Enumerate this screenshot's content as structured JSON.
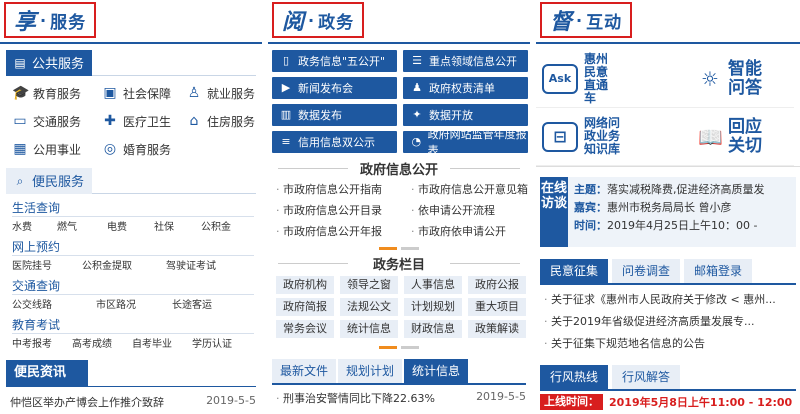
{
  "col1": {
    "glyph": "享",
    "title": "服务",
    "public": {
      "label": "公共服务",
      "items": [
        {
          "icon": "graduation-cap-icon",
          "label": "教育服务"
        },
        {
          "icon": "id-card-icon",
          "label": "社会保障"
        },
        {
          "icon": "person-icon",
          "label": "就业服务"
        },
        {
          "icon": "bus-icon",
          "label": "交通服务"
        },
        {
          "icon": "medical-icon",
          "label": "医疗卫生"
        },
        {
          "icon": "house-icon",
          "label": "住房服务"
        },
        {
          "icon": "building-icon",
          "label": "公用事业"
        },
        {
          "icon": "rings-icon",
          "label": "婚育服务"
        }
      ]
    },
    "convenience": {
      "label": "便民服务",
      "groups": [
        {
          "title": "生活查询",
          "items": [
            "水费",
            "燃气",
            "电费",
            "社保",
            "公积金"
          ]
        },
        {
          "title": "网上预约",
          "items": [
            "医院挂号",
            "公积金提取",
            "驾驶证考试"
          ]
        },
        {
          "title": "交通查询",
          "items": [
            "公交线路",
            "市区路况",
            "长途客运"
          ]
        },
        {
          "title": "教育考试",
          "items": [
            "中考报考",
            "高考成绩",
            "自考毕业",
            "学历认证"
          ]
        }
      ]
    },
    "news": {
      "label": "便民资讯",
      "items": [
        {
          "title": "仲恺区举办产博会上作推介致辞",
          "date": "2019-5-5"
        }
      ]
    }
  },
  "col2": {
    "glyph": "阅",
    "title": "政务",
    "buttons": [
      {
        "icon": "document-icon",
        "label": "政务信息\"五公开\""
      },
      {
        "icon": "list-icon",
        "label": "重点领域信息公开"
      },
      {
        "icon": "video-icon",
        "label": "新闻发布会"
      },
      {
        "icon": "people-icon",
        "label": "政府权责清单"
      },
      {
        "icon": "chart-icon",
        "label": "数据发布"
      },
      {
        "icon": "satellite-icon",
        "label": "数据开放"
      },
      {
        "icon": "database-icon",
        "label": "信用信息双公示"
      },
      {
        "icon": "pie-icon",
        "label": "政府网站监管年度报表"
      }
    ],
    "public_title": "政府信息公开",
    "public_items": [
      "市政府信息公开指南",
      "市政府信息公开意见箱",
      "市政府信息公开目录",
      "依申请公开流程",
      "市政府信息公开年报",
      "市政府依申请公开"
    ],
    "column_title": "政务栏目",
    "column_tags": [
      "政府机构",
      "领导之窗",
      "人事信息",
      "政府公报",
      "政府简报",
      "法规公文",
      "计划规划",
      "重大项目",
      "常务会议",
      "统计信息",
      "财政信息",
      "政策解读"
    ],
    "tabs": [
      "最新文件",
      "规划计划",
      "统计信息"
    ],
    "list": [
      {
        "title": "刑事治安警情同比下降22.63%",
        "date": "2019-5-5"
      }
    ]
  },
  "col3": {
    "glyph": "督",
    "title": "互动",
    "cells": [
      {
        "icon": "ask-icon",
        "badge": "Ask",
        "label": "惠州民意直通车",
        "big": false
      },
      {
        "icon": "lightbulb-icon",
        "label": "智能问答",
        "big": true
      },
      {
        "icon": "inbox-icon",
        "label": "网络问政业务知识库",
        "big": false
      },
      {
        "icon": "book-icon",
        "label": "回应关切",
        "big": true
      }
    ],
    "online": {
      "label": "在线访谈",
      "topic_label": "主题：",
      "topic": "落实减税降费,促进经济高质量发",
      "guest_label": "嘉宾：",
      "guest": "惠州市税务局局长 曾小彦",
      "time_label": "时间：",
      "time": "2019年4月25日上午10：00 -"
    },
    "tabs": [
      "民意征集",
      "问卷调查",
      "邮箱登录"
    ],
    "list": [
      "关于征求《惠州市人民政府关于修改 < 惠州...",
      "关于2019年省级促进经济高质量发展专...",
      "关于征集下规范地名信息的公告"
    ],
    "hotline_tabs": [
      "行风热线",
      "行风解答"
    ],
    "hotline": {
      "label": "上线时间：",
      "text": "2019年5月8日上午11:00 - 12:00"
    }
  }
}
